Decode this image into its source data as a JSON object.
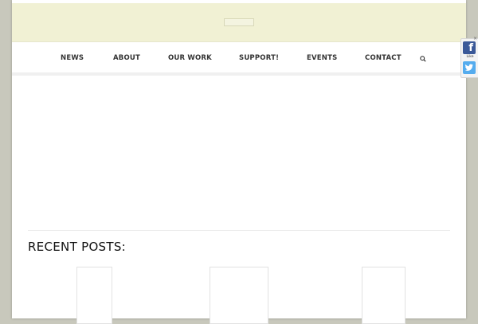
{
  "nav": {
    "items": [
      {
        "label": "NEWS"
      },
      {
        "label": "ABOUT"
      },
      {
        "label": "OUR WORK"
      },
      {
        "label": "SUPPORT!"
      },
      {
        "label": "EVENTS"
      },
      {
        "label": "CONTACT"
      }
    ],
    "search_icon": "search-icon"
  },
  "recent_posts": {
    "title": "RECENT POSTS:"
  },
  "social": {
    "facebook_icon": "facebook-icon",
    "facebook_glyph": "f",
    "like_label": "Like",
    "twitter_icon": "twitter-icon"
  },
  "colors": {
    "header_band": "#f1f1d4",
    "page_background": "#c8c8bc",
    "facebook": "#3b5998",
    "twitter": "#55acee"
  }
}
